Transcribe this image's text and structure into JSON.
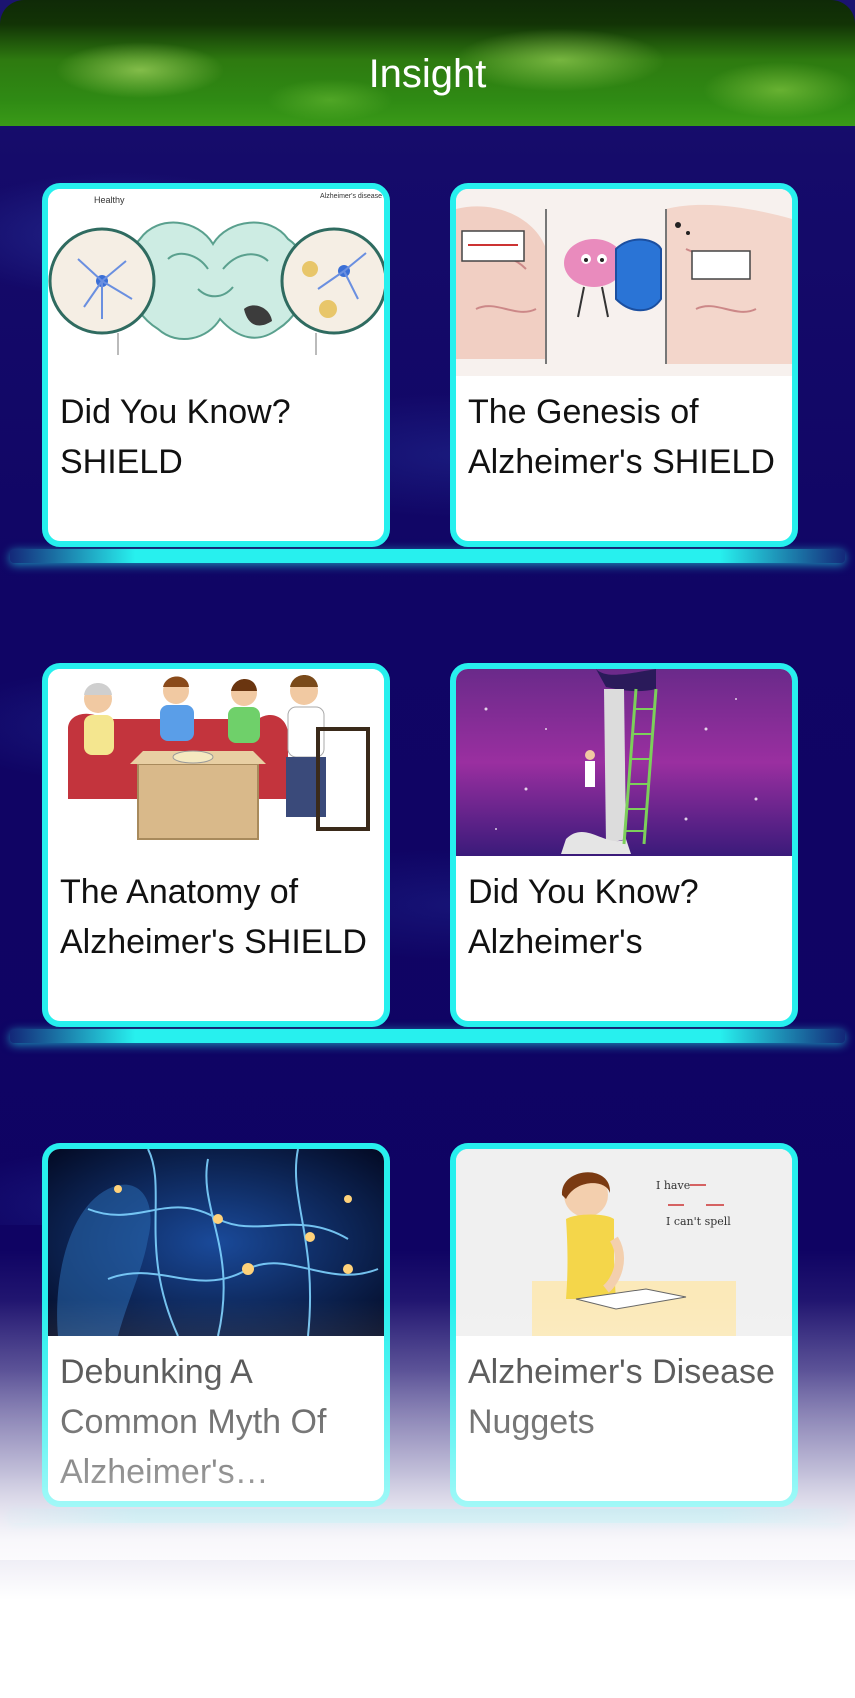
{
  "header": {
    "title": "Insight"
  },
  "cards": [
    {
      "title": "Did You Know? SHIELD",
      "image": "brain-neurons-comparison-illustration"
    },
    {
      "title": "The Genesis of Alzheimer's SHIELD",
      "image": "brain-shield-cartoon-illustration"
    },
    {
      "title": "The Anatomy of Alzheimer's SHIELD",
      "image": "family-gathering-illustration"
    },
    {
      "title": "Did You Know? Alzheimer's",
      "image": "ladder-scroll-purple-illustration"
    },
    {
      "title": "Debunking A Common Myth Of Alzheimer's…",
      "image": "glowing-neural-network-image"
    },
    {
      "title": "Alzheimer's Disease Nuggets",
      "image": "woman-writing-illustration"
    }
  ],
  "thumb_text": {
    "healthy": "Healthy",
    "disease": "Alzheimer's disease",
    "note_line1": "I have",
    "note_line2": "I can't spell"
  },
  "colors": {
    "accent": "#27f0ee",
    "background": "#100565",
    "header_green": "#2f8a14"
  }
}
